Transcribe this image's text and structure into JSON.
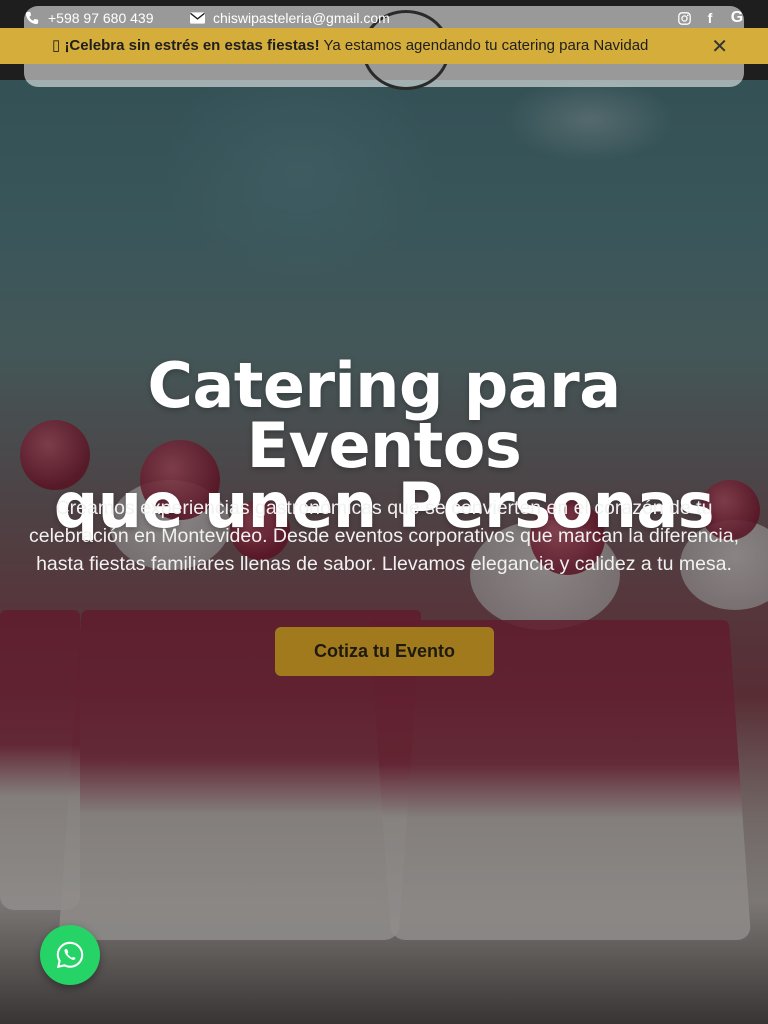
{
  "topbar": {
    "phone": "+598 97 680 439",
    "email": "chiswipasteleria@gmail.com",
    "phone_icon": "phone-icon",
    "email_icon": "envelope-icon",
    "social": [
      {
        "name": "instagram-icon",
        "glyph": "◎"
      },
      {
        "name": "facebook-icon",
        "glyph": "f"
      },
      {
        "name": "google-icon",
        "glyph": "G"
      }
    ]
  },
  "banner": {
    "emoji": "▯",
    "strong": "¡Celebra sin estrés en estas fiestas!",
    "text": " Ya estamos agendando tu catering para Navidad",
    "close": "✕"
  },
  "hero": {
    "title_line1": "Catering para Eventos",
    "title_line2": "que unen Personas",
    "subtitle": "Creamos experiencias gastronómicas que se convierten en el corazón de tu celebración en Montevideo. Desde eventos corporativos que marcan la diferencia, hasta fiestas familiares llenas de sabor. Llevamos elegancia y calidez a tu mesa.",
    "cta": "Cotiza tu Evento"
  },
  "colors": {
    "banner": "#d4ad3a",
    "cta": "#a07a1d",
    "whatsapp": "#25d366"
  }
}
